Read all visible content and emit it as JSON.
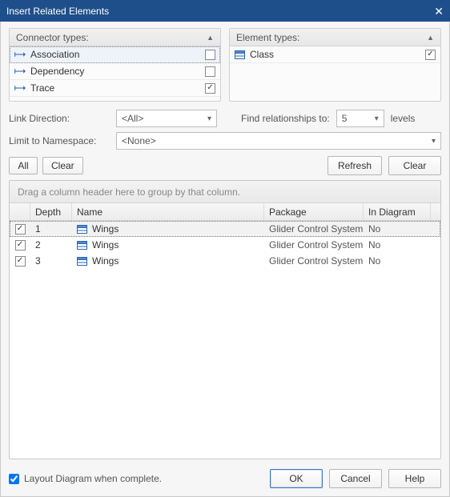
{
  "title": "Insert Related Elements",
  "connector_panel": {
    "title": "Connector types:",
    "items": [
      {
        "label": "Association",
        "checked": false
      },
      {
        "label": "Dependency",
        "checked": false
      },
      {
        "label": "Trace",
        "checked": true
      }
    ]
  },
  "element_panel": {
    "title": "Element types:",
    "items": [
      {
        "label": "Class",
        "checked": true
      }
    ]
  },
  "labels": {
    "link_direction": "Link Direction:",
    "limit_namespace": "Limit to Namespace:",
    "find_rel": "Find relationships to:",
    "levels": "levels",
    "all": "All",
    "clear": "Clear",
    "refresh": "Refresh",
    "group_hint": "Drag a column header here to group by that column.",
    "layout_checkbox": "Layout Diagram when complete.",
    "ok": "OK",
    "cancel": "Cancel",
    "help": "Help"
  },
  "link_direction_value": "<All>",
  "namespace_value": "<None>",
  "levels_value": "5",
  "columns": {
    "depth": "Depth",
    "name": "Name",
    "package": "Package",
    "in_diagram": "In Diagram"
  },
  "rows": [
    {
      "checked": true,
      "depth": "1",
      "name": "Wings",
      "package": "Glider Control System",
      "in_diagram": "No",
      "selected": true
    },
    {
      "checked": true,
      "depth": "2",
      "name": "Wings",
      "package": "Glider Control System",
      "in_diagram": "No",
      "selected": false
    },
    {
      "checked": true,
      "depth": "3",
      "name": "Wings",
      "package": "Glider Control System",
      "in_diagram": "No",
      "selected": false
    }
  ],
  "layout_checked": true
}
